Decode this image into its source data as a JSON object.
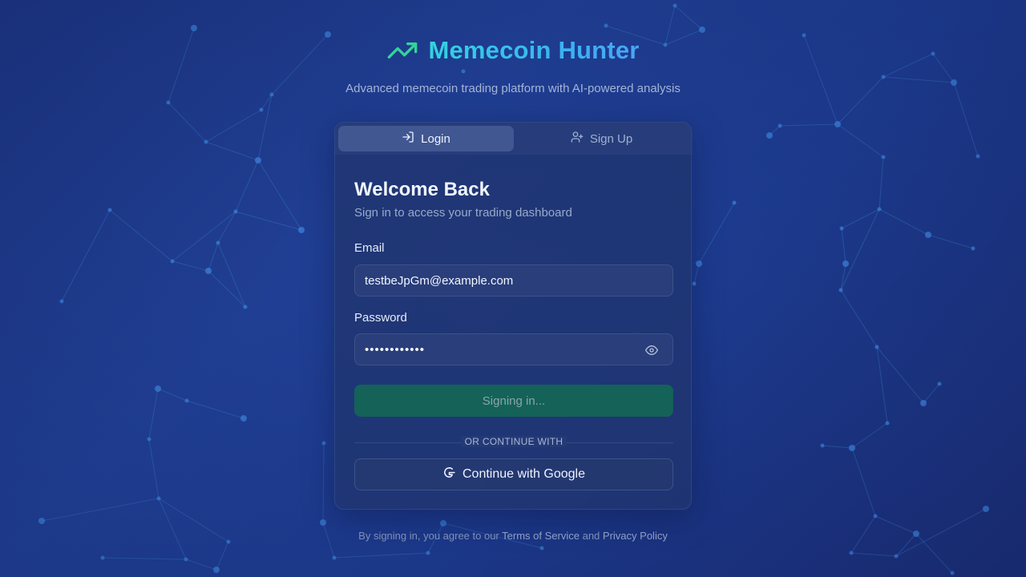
{
  "brand": {
    "title": "Memecoin Hunter",
    "tagline": "Advanced memecoin trading platform with AI-powered analysis",
    "icon": "trending-up-icon",
    "accent_color": "#34d399"
  },
  "tabs": [
    {
      "label": "Login",
      "icon": "log-in-icon",
      "active": true
    },
    {
      "label": "Sign Up",
      "icon": "user-plus-icon",
      "active": false
    }
  ],
  "form": {
    "title": "Welcome Back",
    "subtitle": "Sign in to access your trading dashboard",
    "email_label": "Email",
    "email_value": "testbeJpGm@example.com",
    "password_label": "Password",
    "password_value": "••••••••••••",
    "submit_label": "Signing in...",
    "divider_text": "OR CONTINUE WITH",
    "google_label": "Continue with Google"
  },
  "footer": {
    "prefix": "By signing in, you agree to our",
    "terms": "Terms of Service",
    "and": "and",
    "privacy": "Privacy Policy"
  },
  "colors": {
    "background": "#2446a0",
    "submit_bg": "#146258",
    "title_gradient_start": "#34d3e0",
    "title_gradient_end": "#4aa4f6"
  }
}
